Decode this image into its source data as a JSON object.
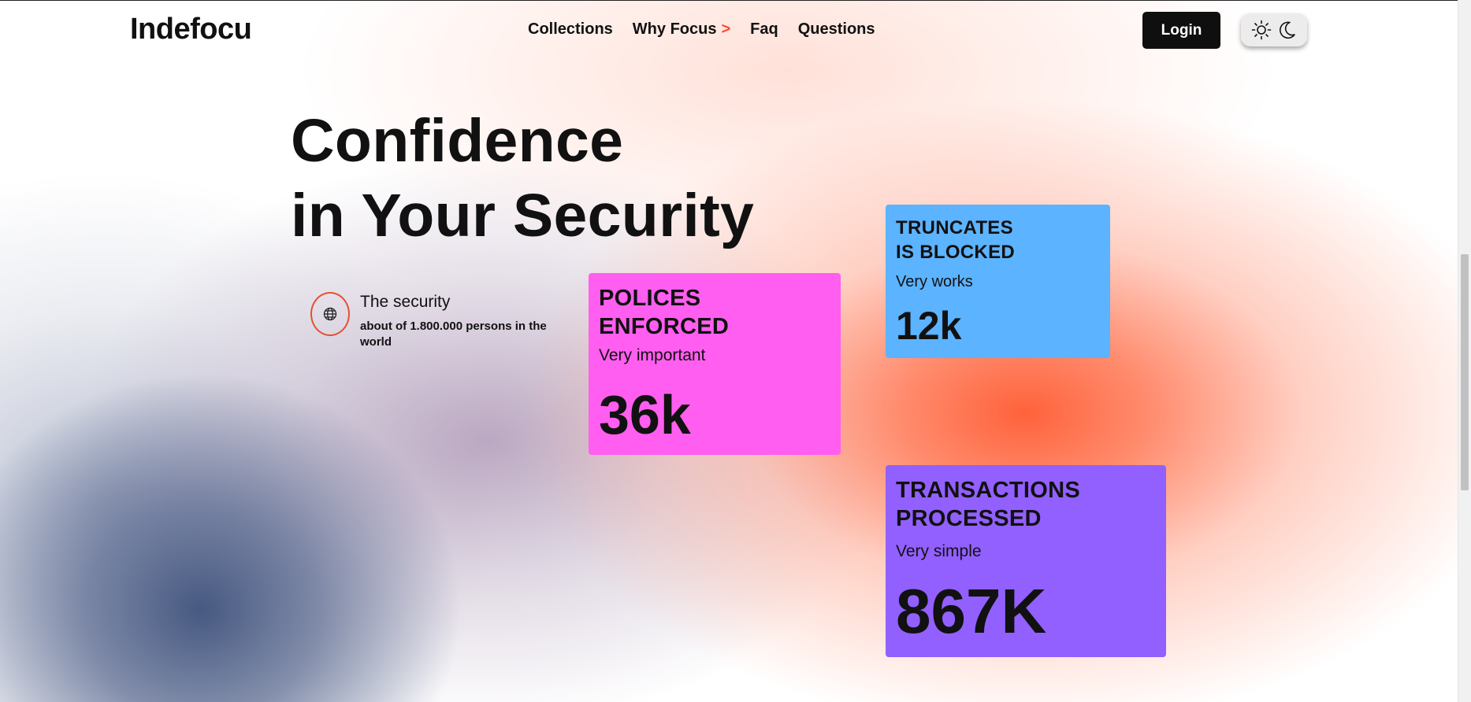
{
  "header": {
    "logo": "Indefocu",
    "nav": [
      {
        "label": "Collections"
      },
      {
        "label": "Why Focus",
        "marker": ">"
      },
      {
        "label": "Faq"
      },
      {
        "label": "Questions"
      }
    ],
    "login_label": "Login",
    "theme_toggle": {
      "icons": [
        "sun-icon",
        "moon-icon"
      ]
    }
  },
  "hero": {
    "line1": "Confidence",
    "line2": "in Your Security"
  },
  "security": {
    "title": "The security",
    "subtitle": "about of 1.800.000 persons in the world",
    "icon": "globe-icon"
  },
  "cards": [
    {
      "title_line1": "POLICES",
      "title_line2": "ENFORCED",
      "subtitle": "Very important",
      "value": "36k",
      "color": "#ff5ef0"
    },
    {
      "title_line1": "TRUNCATES",
      "title_line2": "IS BLOCKED",
      "subtitle": "Very works",
      "value": "12k",
      "color": "#5cb3ff"
    },
    {
      "title_line1": "TRANSACTIONS",
      "title_line2": "PROCESSED",
      "subtitle": "Very simple",
      "value": "867K",
      "color": "#9260ff"
    }
  ],
  "colors": {
    "accent": "#ff4b2b",
    "login_bg": "#0f0f0f"
  }
}
